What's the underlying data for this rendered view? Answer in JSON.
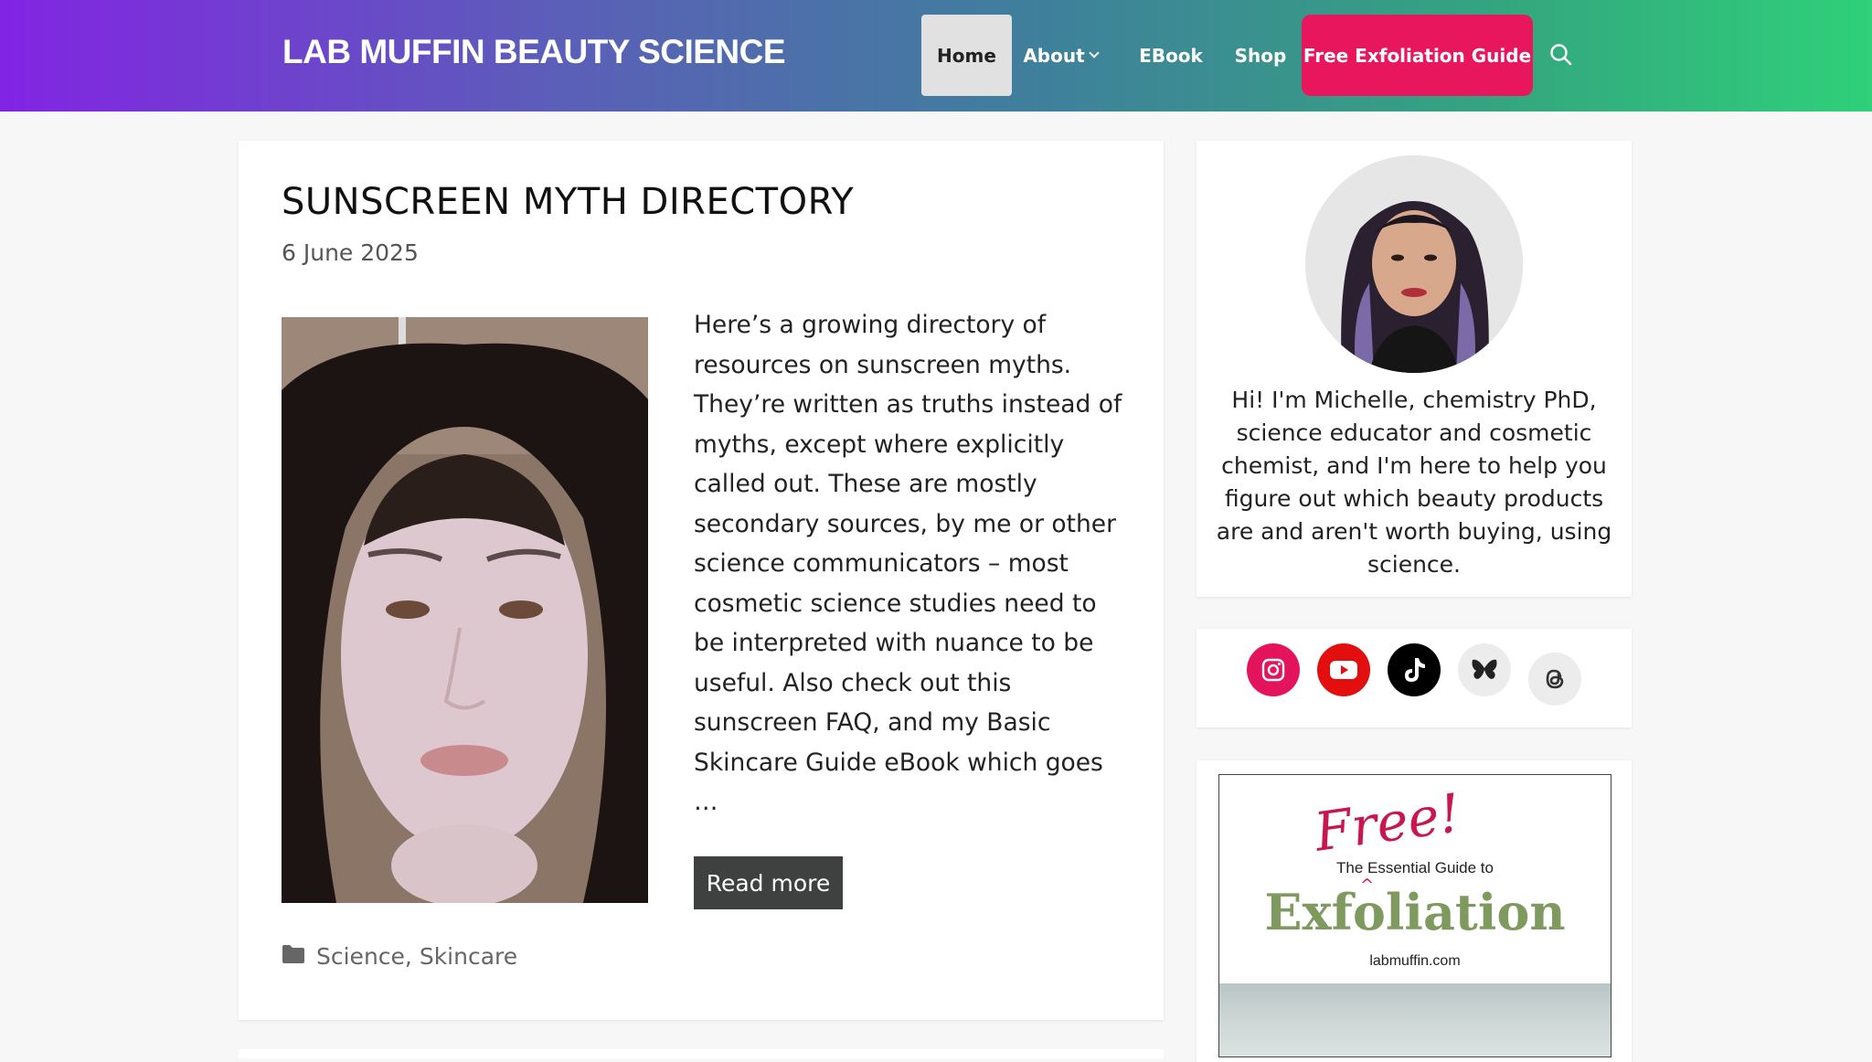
{
  "header": {
    "site_title": "LAB MUFFIN BEAUTY SCIENCE",
    "nav": {
      "home": "Home",
      "about": "About",
      "ebook": "EBook",
      "shop": "Shop",
      "cta": "Free Exfoliation Guide"
    },
    "search_icon": "search-icon",
    "colors": {
      "gradient_start": "#8224e3",
      "gradient_end": "#2fd07a",
      "cta": "#e8175d"
    }
  },
  "article": {
    "title": "SUNSCREEN MYTH DIRECTORY",
    "date": "6 June 2025",
    "excerpt": "Here’s a growing directory of resources on sunscreen myths. They’re written as truths instead of myths, except where explicitly called out. These are mostly secondary sources, by me or other science communicators – most cosmetic science studies need to be interpreted with nuance to be useful. Also check out this sunscreen FAQ, and my Basic Skincare Guide eBook which goes …",
    "read_more": "Read more",
    "categories": [
      "Science",
      "Skincare"
    ],
    "category_icon": "folder-icon"
  },
  "sidebar": {
    "about_text": "Hi! I'm Michelle, chemistry PhD, science educator and cosmetic chemist, and I'm here to help you figure out which beauty products are and aren't worth buying, using science.",
    "social": [
      "instagram-icon",
      "youtube-icon",
      "tiktok-icon",
      "bluesky-icon",
      "threads-icon"
    ],
    "promo": {
      "free": "Free!",
      "subtitle": "The Essential Guide to",
      "title": "Exfoliation",
      "url": "labmuffin.com"
    }
  }
}
